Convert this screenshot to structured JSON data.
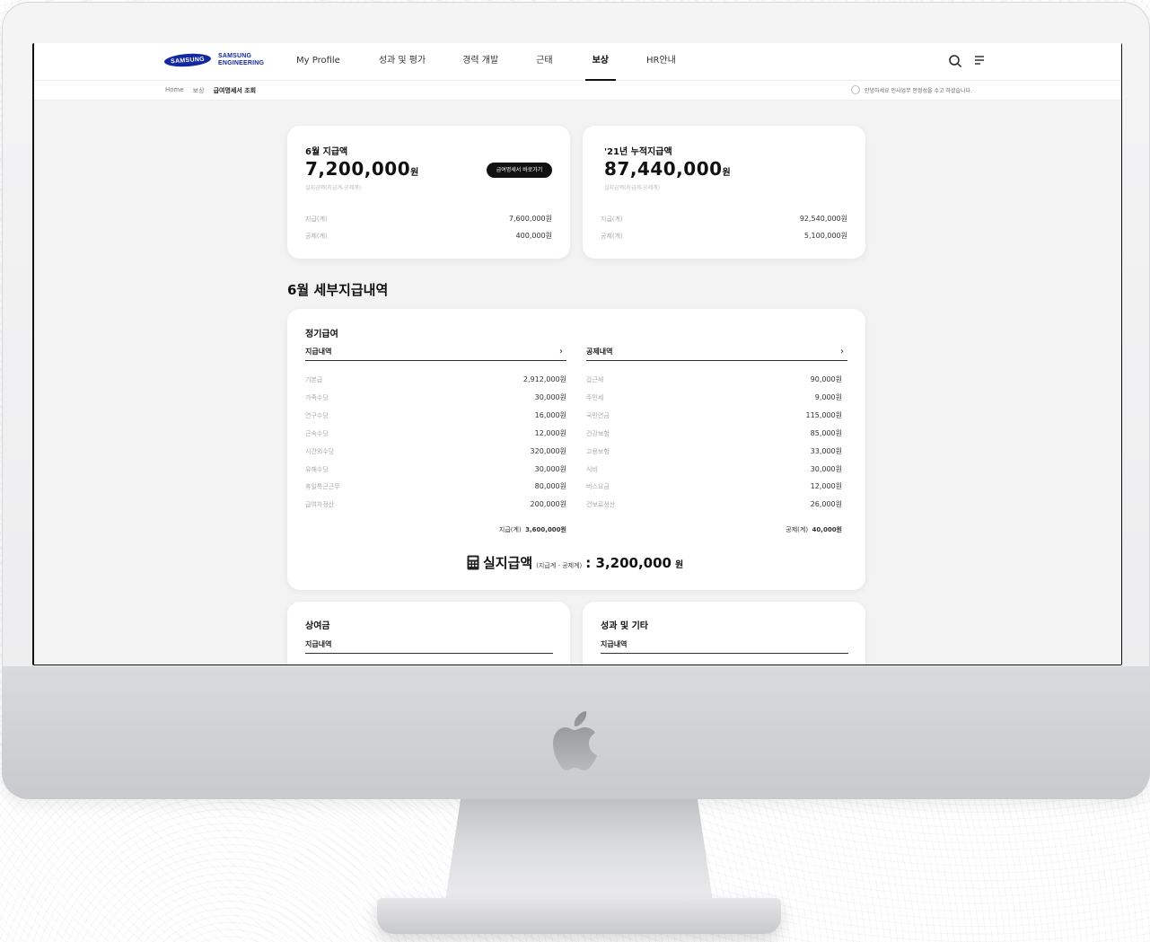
{
  "header": {
    "brand_samsung": "SAMSUNG",
    "brand_line1": "SAMSUNG",
    "brand_line2": "ENGINEERING",
    "nav": [
      {
        "label": "My Profile"
      },
      {
        "label": "성과 및 평가"
      },
      {
        "label": "경력 개발"
      },
      {
        "label": "근태"
      },
      {
        "label": "보상",
        "active": true
      },
      {
        "label": "HR안내"
      }
    ]
  },
  "breadcrumb": {
    "items": [
      "Home",
      "보상",
      "급여명세서 조회"
    ],
    "notice": "안녕하세요 인사업무 안정성을 수고 하셨습니다."
  },
  "summary": {
    "monthly": {
      "title": "6월 지급액",
      "amount": "7,200,000",
      "unit": "원",
      "note": "실지급액(지급계-공제계)",
      "button": "급여명세서 바로가기",
      "rows": [
        {
          "label": "지급(계)",
          "value": "7,600,000원"
        },
        {
          "label": "공제(계)",
          "value": "400,000원"
        }
      ]
    },
    "annual": {
      "title": "'21년 누적지급액",
      "amount": "87,440,000",
      "unit": "원",
      "note": "실지급액(지급계-공제계)",
      "rows": [
        {
          "label": "지급(계)",
          "value": "92,540,000원"
        },
        {
          "label": "공제(계)",
          "value": "5,100,000원"
        }
      ]
    }
  },
  "detail": {
    "section_title": "6월 세부지급내역",
    "regular": {
      "title": "정기급여",
      "pay_head": "지급내역",
      "deduct_head": "공제내역",
      "pay_rows": [
        {
          "label": "기본급",
          "value": "2,912,000원"
        },
        {
          "label": "가족수당",
          "value": "30,000원"
        },
        {
          "label": "연구수당",
          "value": "16,000원"
        },
        {
          "label": "근속수당",
          "value": "12,000원"
        },
        {
          "label": "시간외수당",
          "value": "320,000원"
        },
        {
          "label": "유해수당",
          "value": "30,000원"
        },
        {
          "label": "휴일특근근무",
          "value": "80,000원"
        },
        {
          "label": "급여차정산",
          "value": "200,000원"
        }
      ],
      "deduct_rows": [
        {
          "label": "갑근세",
          "value": "90,000원"
        },
        {
          "label": "주민세",
          "value": "9,000원"
        },
        {
          "label": "국민연금",
          "value": "115,000원"
        },
        {
          "label": "건강보험",
          "value": "85,000원"
        },
        {
          "label": "고용보험",
          "value": "33,000원"
        },
        {
          "label": "식비",
          "value": "30,000원"
        },
        {
          "label": "버스요금",
          "value": "12,000원"
        },
        {
          "label": "건보료정산",
          "value": "26,000원"
        }
      ],
      "pay_total_label": "지급(계)",
      "pay_total_value": "3,600,000원",
      "deduct_total_label": "공제(계)",
      "deduct_total_value": "40,000원",
      "net_label": "실지급액",
      "net_hint": "(지급계 - 공제계)",
      "net_value": ": 3,200,000",
      "net_unit": "원"
    },
    "bonus": {
      "title": "상여금",
      "head": "지급내역"
    },
    "etc": {
      "title": "성과 및 기타",
      "head": "지급내역"
    }
  }
}
